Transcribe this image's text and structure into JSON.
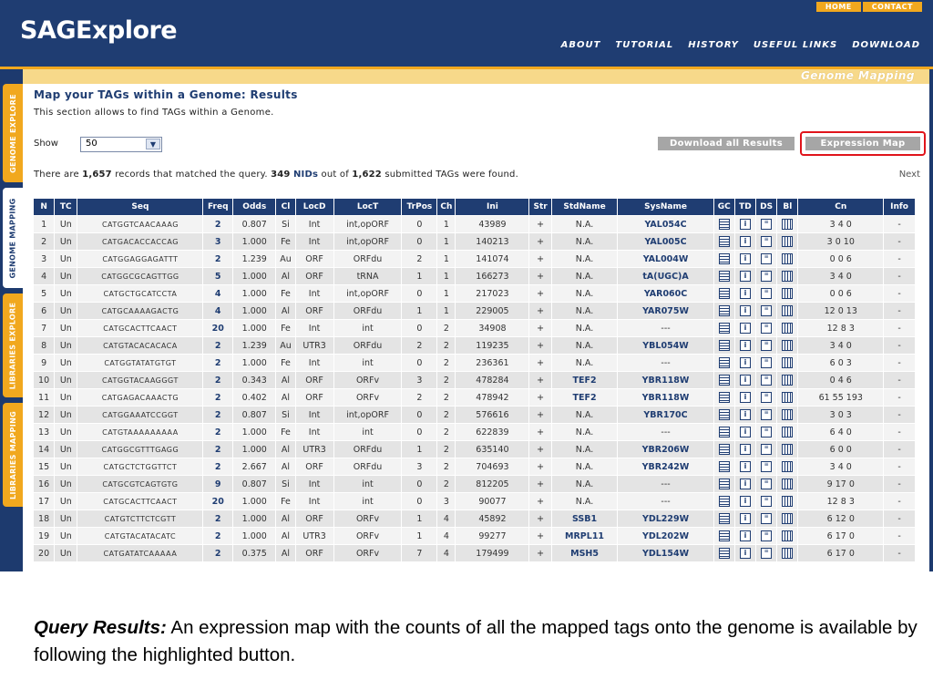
{
  "app": {
    "logo": "SAGExplore",
    "top_links": [
      "HOME",
      "CONTACT"
    ],
    "main_nav": [
      "ABOUT",
      "TUTORIAL",
      "HISTORY",
      "USEFUL LINKS",
      "DOWNLOAD"
    ],
    "section_title": "Genome Mapping",
    "side_tabs": [
      "GENOME EXPLORE",
      "GENOME MAPPING",
      "LIBRARIES EXPLORE",
      "LIBRARIES MAPPING"
    ],
    "active_side_tab": "GENOME MAPPING"
  },
  "page": {
    "title": "Map your TAGs within a Genome: Results",
    "subtitle": "This section allows to find TAGs within a Genome.",
    "show_label": "Show",
    "show_value": "50",
    "download_button": "Download all Results",
    "expression_button": "Expression Map",
    "summary": {
      "prefix": "There are ",
      "records": "1,657",
      "mid1": " records that matched the query. ",
      "nids": "349",
      "nids_label": "NIDs",
      "mid2": " out of ",
      "total": "1,622",
      "suffix": " submitted TAGs were found."
    },
    "next_label": "Next"
  },
  "table": {
    "columns": [
      "N",
      "TC",
      "Seq",
      "Freq",
      "Odds",
      "Cl",
      "LocD",
      "LocT",
      "TrPos",
      "Ch",
      "Ini",
      "Str",
      "StdName",
      "SysName",
      "GC",
      "TD",
      "DS",
      "Bl",
      "Cn",
      "Info"
    ],
    "rows": [
      [
        "1",
        "Un",
        "CATGGTCAACAAAG",
        "2",
        "0.807",
        "Si",
        "Int",
        "int,opORF",
        "0",
        "1",
        "43989",
        "+",
        "N.A.",
        "YAL054C",
        "3 4 0",
        "-"
      ],
      [
        "2",
        "Un",
        "CATGACACCACCAG",
        "3",
        "1.000",
        "Fe",
        "Int",
        "int,opORF",
        "0",
        "1",
        "140213",
        "+",
        "N.A.",
        "YAL005C",
        "3 0 10",
        "-"
      ],
      [
        "3",
        "Un",
        "CATGGAGGAGATTT",
        "2",
        "1.239",
        "Au",
        "ORF",
        "ORFdu",
        "2",
        "1",
        "141074",
        "+",
        "N.A.",
        "YAL004W",
        "0 0 6",
        "-"
      ],
      [
        "4",
        "Un",
        "CATGGCGCAGTTGG",
        "5",
        "1.000",
        "Al",
        "ORF",
        "tRNA",
        "1",
        "1",
        "166273",
        "+",
        "N.A.",
        "tA(UGC)A",
        "3 4 0",
        "-"
      ],
      [
        "5",
        "Un",
        "CATGCTGCATCCTA",
        "4",
        "1.000",
        "Fe",
        "Int",
        "int,opORF",
        "0",
        "1",
        "217023",
        "+",
        "N.A.",
        "YAR060C",
        "0 0 6",
        "-"
      ],
      [
        "6",
        "Un",
        "CATGCAAAAGACTG",
        "4",
        "1.000",
        "Al",
        "ORF",
        "ORFdu",
        "1",
        "1",
        "229005",
        "+",
        "N.A.",
        "YAR075W",
        "12 0 13",
        "-"
      ],
      [
        "7",
        "Un",
        "CATGCACTTCAACT",
        "20",
        "1.000",
        "Fe",
        "Int",
        "int",
        "0",
        "2",
        "34908",
        "+",
        "N.A.",
        "---",
        "12 8 3",
        "-"
      ],
      [
        "8",
        "Un",
        "CATGTACACACACA",
        "2",
        "1.239",
        "Au",
        "UTR3",
        "ORFdu",
        "2",
        "2",
        "119235",
        "+",
        "N.A.",
        "YBL054W",
        "3 4 0",
        "-"
      ],
      [
        "9",
        "Un",
        "CATGGTATATGTGT",
        "2",
        "1.000",
        "Fe",
        "Int",
        "int",
        "0",
        "2",
        "236361",
        "+",
        "N.A.",
        "---",
        "6 0 3",
        "-"
      ],
      [
        "10",
        "Un",
        "CATGGTACAAGGGT",
        "2",
        "0.343",
        "Al",
        "ORF",
        "ORFv",
        "3",
        "2",
        "478284",
        "+",
        "TEF2",
        "YBR118W",
        "0 4 6",
        "-"
      ],
      [
        "11",
        "Un",
        "CATGAGACAAACTG",
        "2",
        "0.402",
        "Al",
        "ORF",
        "ORFv",
        "2",
        "2",
        "478942",
        "+",
        "TEF2",
        "YBR118W",
        "61 55 193",
        "-"
      ],
      [
        "12",
        "Un",
        "CATGGAAATCCGGT",
        "2",
        "0.807",
        "Si",
        "Int",
        "int,opORF",
        "0",
        "2",
        "576616",
        "+",
        "N.A.",
        "YBR170C",
        "3 0 3",
        "-"
      ],
      [
        "13",
        "Un",
        "CATGTAAAAAAAAA",
        "2",
        "1.000",
        "Fe",
        "Int",
        "int",
        "0",
        "2",
        "622839",
        "+",
        "N.A.",
        "---",
        "6 4 0",
        "-"
      ],
      [
        "14",
        "Un",
        "CATGGCGTTTGAGG",
        "2",
        "1.000",
        "Al",
        "UTR3",
        "ORFdu",
        "1",
        "2",
        "635140",
        "+",
        "N.A.",
        "YBR206W",
        "6 0 0",
        "-"
      ],
      [
        "15",
        "Un",
        "CATGCTCTGGTTCT",
        "2",
        "2.667",
        "Al",
        "ORF",
        "ORFdu",
        "3",
        "2",
        "704693",
        "+",
        "N.A.",
        "YBR242W",
        "3 4 0",
        "-"
      ],
      [
        "16",
        "Un",
        "CATGCGTCAGTGTG",
        "9",
        "0.807",
        "Si",
        "Int",
        "int",
        "0",
        "2",
        "812205",
        "+",
        "N.A.",
        "---",
        "9 17 0",
        "-"
      ],
      [
        "17",
        "Un",
        "CATGCACTTCAACT",
        "20",
        "1.000",
        "Fe",
        "Int",
        "int",
        "0",
        "3",
        "90077",
        "+",
        "N.A.",
        "---",
        "12 8 3",
        "-"
      ],
      [
        "18",
        "Un",
        "CATGTCTTCTCGTT",
        "2",
        "1.000",
        "Al",
        "ORF",
        "ORFv",
        "1",
        "4",
        "45892",
        "+",
        "SSB1",
        "YDL229W",
        "6 12 0",
        "-"
      ],
      [
        "19",
        "Un",
        "CATGTACATACATC",
        "2",
        "1.000",
        "Al",
        "UTR3",
        "ORFv",
        "1",
        "4",
        "99277",
        "+",
        "MRPL11",
        "YDL202W",
        "6 17 0",
        "-"
      ],
      [
        "20",
        "Un",
        "CATGATATCAAAAA",
        "2",
        "0.375",
        "Al",
        "ORF",
        "ORFv",
        "7",
        "4",
        "179499",
        "+",
        "MSH5",
        "YDL154W",
        "6 17 0",
        "-"
      ]
    ]
  },
  "caption": {
    "label": "Query Results:",
    "text": " An expression map with the counts of all the mapped tags onto the genome is available by following the highlighted button."
  }
}
